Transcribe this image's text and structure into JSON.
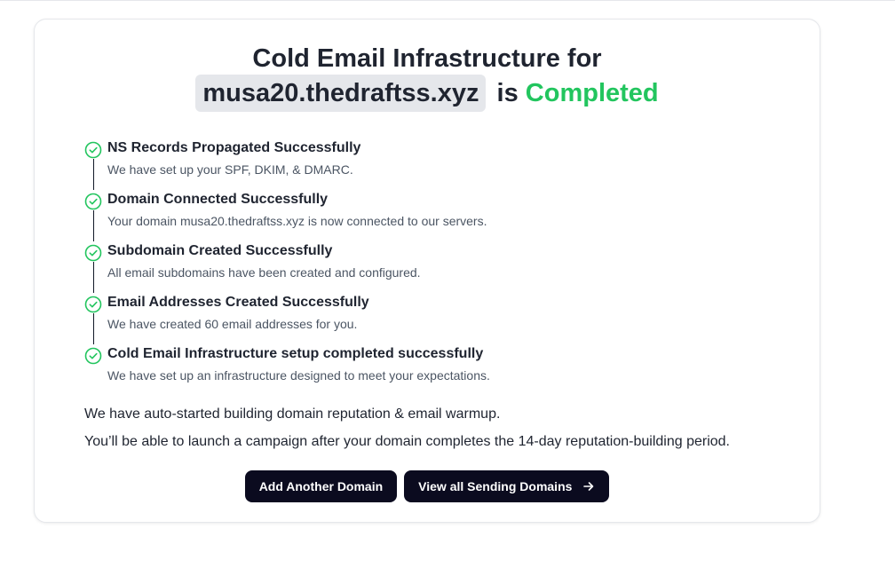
{
  "card": {
    "title_prefix": "Cold Email Infrastructure for",
    "domain": "musa20.thedraftss.xyz",
    "title_is": "is",
    "status": "Completed"
  },
  "steps": [
    {
      "title": "NS Records Propagated Successfully",
      "desc": "We have set up your SPF, DKIM, & DMARC."
    },
    {
      "title": "Domain Connected Successfully",
      "desc": "Your domain musa20.thedraftss.xyz is now connected to our servers."
    },
    {
      "title": "Subdomain Created Successfully",
      "desc": "All email subdomains have been created and configured."
    },
    {
      "title": "Email Addresses Created Successfully",
      "desc": "We have created 60 email addresses for you."
    },
    {
      "title": "Cold Email Infrastructure setup completed successfully",
      "desc": "We have set up an infrastructure designed to meet your expectations."
    }
  ],
  "notes": {
    "warmup": "We have auto-started building domain reputation & email warmup.",
    "launch": "You’ll be able to launch a campaign after your domain completes the 14-day reputation-building period."
  },
  "actions": {
    "add_domain": "Add Another Domain",
    "view_domains": "View all Sending Domains",
    "view_domains_icon": "arrow-right-icon"
  },
  "colors": {
    "success": "#22c55e",
    "button_bg": "#0b0b1f",
    "chip_bg": "#e5e7eb"
  },
  "icons": {
    "step_icon": "check-circle-icon"
  }
}
